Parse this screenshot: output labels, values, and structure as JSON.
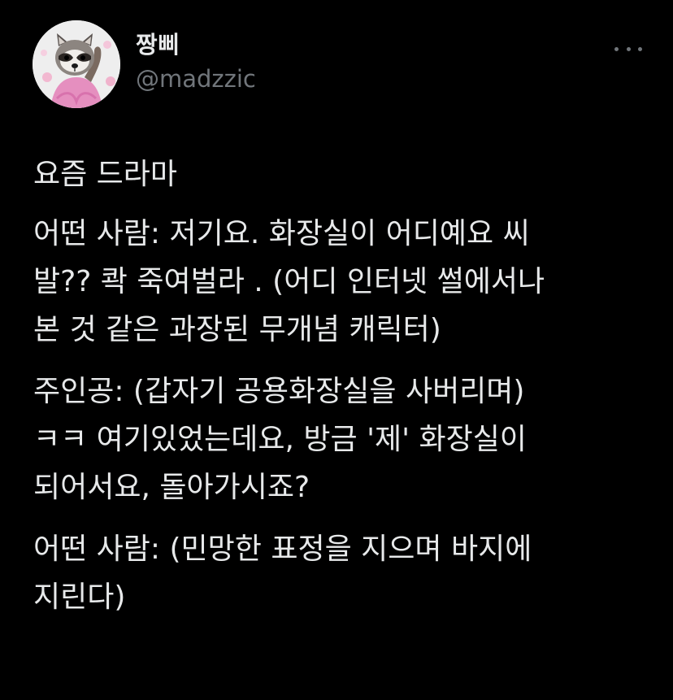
{
  "user": {
    "display_name": "짱삐",
    "handle": "@madzzic",
    "avatar_icon": "raccoon-avatar-icon"
  },
  "menu": {
    "icon": "more-options-icon"
  },
  "tweet": {
    "paragraphs": [
      "요즘 드라마",
      "어떤 사람: 저기요. 화장실이 어디예요 씨\n발?? 콱 죽여벌라 . (어디 인터넷 썰에서나\n본 것 같은 과장된 무개념 캐릭터)",
      "주인공: (갑자기 공용화장실을 사버리며)\nㅋㅋ 여기있었는데요, 방금 '제' 화장실이\n되어서요, 돌아가시죠?",
      "어떤 사람: (민망한 표정을 지으며 바지에\n지린다)"
    ]
  },
  "colors": {
    "background": "#000000",
    "text_primary": "#e7e9ea",
    "text_secondary": "#71767b"
  }
}
